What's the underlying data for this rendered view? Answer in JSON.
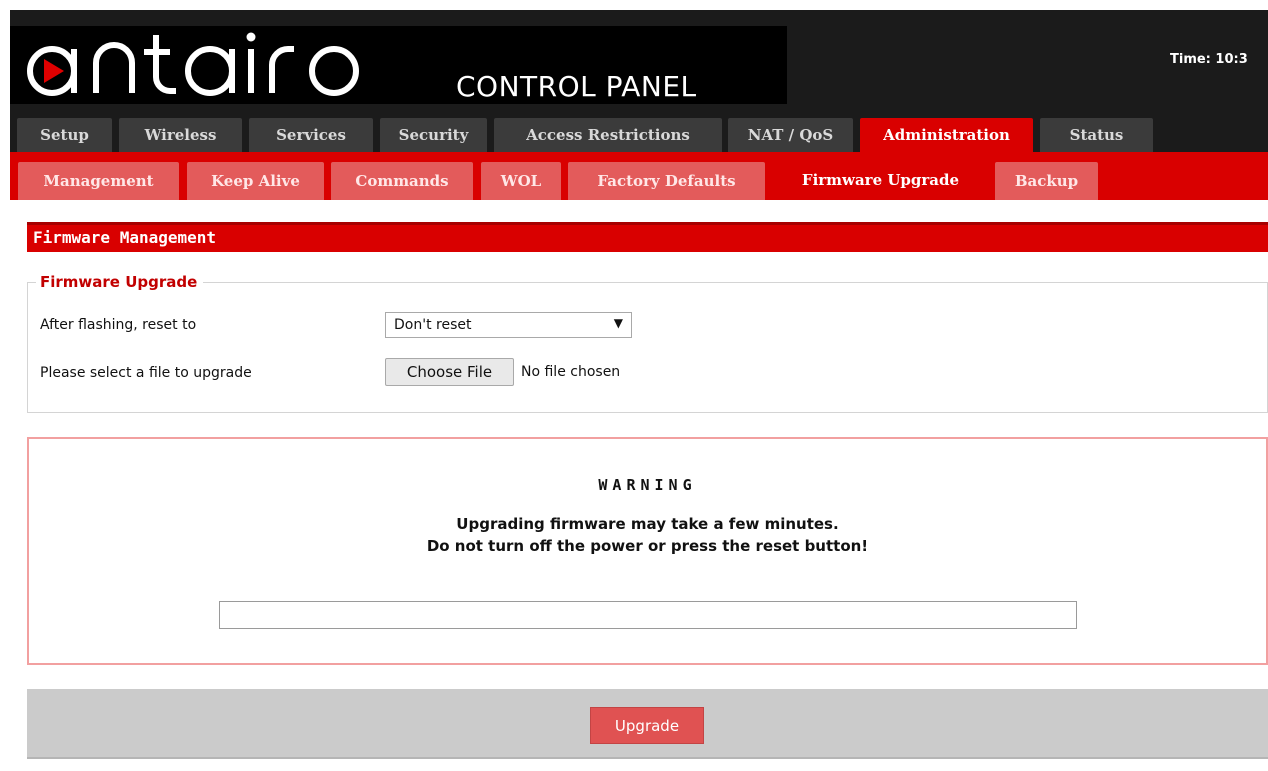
{
  "header": {
    "logo_text": "antaira",
    "control_panel": "CONTROL PANEL",
    "time_label": "Time: 10:3"
  },
  "main_tabs": [
    {
      "label": "Setup"
    },
    {
      "label": "Wireless"
    },
    {
      "label": "Services"
    },
    {
      "label": "Security"
    },
    {
      "label": "Access Restrictions"
    },
    {
      "label": "NAT / QoS"
    },
    {
      "label": "Administration"
    },
    {
      "label": "Status"
    }
  ],
  "sub_tabs": [
    {
      "label": "Management"
    },
    {
      "label": "Keep Alive"
    },
    {
      "label": "Commands"
    },
    {
      "label": "WOL"
    },
    {
      "label": "Factory Defaults"
    },
    {
      "label": "Firmware Upgrade"
    },
    {
      "label": "Backup"
    }
  ],
  "section": {
    "title": "Firmware Management"
  },
  "firmware_upgrade": {
    "legend": "Firmware Upgrade",
    "reset_label": "After flashing, reset to",
    "reset_value": "Don't reset",
    "file_label": "Please select a file to upgrade",
    "choose_file_label": "Choose File",
    "file_status": "No file chosen"
  },
  "warning": {
    "title": "WARNING",
    "line1": "Upgrading firmware may take a few minutes.",
    "line2": "Do not turn off the power or press the reset button!",
    "progress_fraction": 0
  },
  "footer": {
    "upgrade_label": "Upgrade"
  },
  "colors": {
    "accent": "#d90000",
    "inactive_main_tab": "#3b3b3b",
    "inactive_sub_tab": "#e35b5b",
    "warning_border": "#f2a0a0"
  }
}
